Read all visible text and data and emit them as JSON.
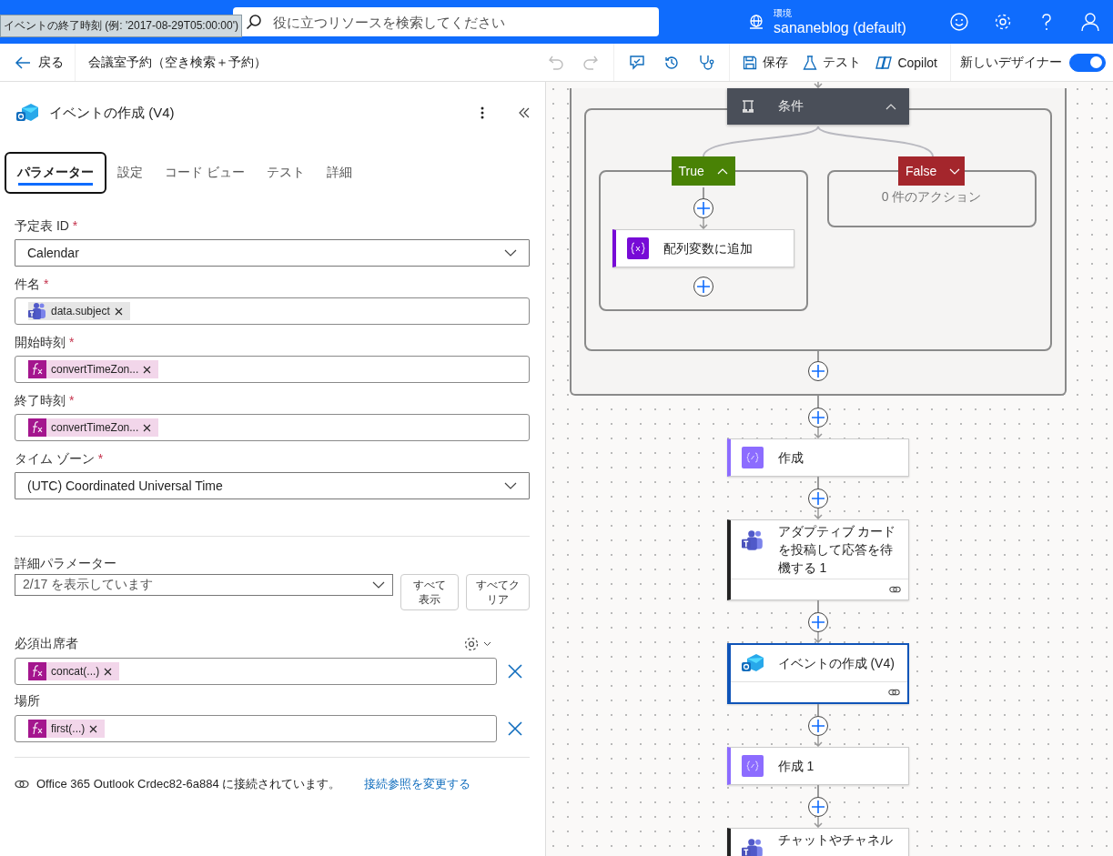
{
  "header": {
    "tooltip": "イベントの終了時刻 (例: '2017-08-29T05:00:00')",
    "search": {
      "placeholder": "役に立つリソースを検索してください"
    },
    "environment": {
      "label": "環境",
      "name": "sananeblog (default)"
    }
  },
  "toolbar": {
    "back": "戻る",
    "flow_name": "会議室予約（空き検索＋予約）",
    "undo": {
      "disabled": true
    },
    "redo": {
      "disabled": true
    },
    "actions": [
      {
        "kind": "save",
        "label": "保存"
      },
      {
        "kind": "test",
        "label": "テスト"
      },
      {
        "kind": "copilot",
        "label": "Copilot"
      }
    ],
    "new_designer": {
      "label": "新しいデザイナー",
      "on": true
    }
  },
  "panel": {
    "title": "イベントの作成 (V4)",
    "tabs": [
      {
        "label": "パラメーター",
        "selected": true
      },
      {
        "label": "設定",
        "selected": false
      },
      {
        "label": "コード ビュー",
        "selected": false
      },
      {
        "label": "テスト",
        "selected": false
      },
      {
        "label": "詳細",
        "selected": false
      }
    ],
    "fields": [
      {
        "kind": "dropdown",
        "label": "予定表 ID",
        "mark": "*",
        "value": "Calendar"
      },
      {
        "kind": "tokens",
        "label": "件名",
        "mark": "*",
        "tokens": [
          {
            "kind": "teams",
            "text": "data.subject"
          }
        ]
      },
      {
        "kind": "tokens",
        "label": "開始時刻",
        "mark": "*",
        "tokens": [
          {
            "kind": "expression",
            "text": "convertTimeZon..."
          }
        ]
      },
      {
        "kind": "tokens",
        "label": "終了時刻",
        "mark": "*",
        "tokens": [
          {
            "kind": "expression",
            "text": "convertTimeZon..."
          }
        ]
      },
      {
        "kind": "dropdown",
        "label": "タイム ゾーン",
        "mark": "*",
        "value": "(UTC) Coordinated Universal Time"
      }
    ],
    "advanced": {
      "label": "詳細パラメーター",
      "summary": "2/17 を表示しています",
      "buttons": [
        "すべて表示",
        "すべてクリア"
      ]
    },
    "optional_fields": [
      {
        "label": "必須出席者",
        "settings": true,
        "tokens": [
          {
            "kind": "expression",
            "text": "concat(...)"
          }
        ]
      },
      {
        "label": "場所",
        "settings": false,
        "tokens": [
          {
            "kind": "expression",
            "text": "first(...)"
          }
        ]
      }
    ],
    "connection": {
      "text": "Office 365 Outlook Crdec82-6a884 に接続されています。",
      "link": "接続参照を変更する"
    }
  },
  "canvas": {
    "condition": {
      "title": "条件",
      "expanded": true,
      "branches": [
        {
          "kind": "true",
          "label": "True",
          "expanded": true,
          "actions": [
            {
              "kind": "variable",
              "title": "配列変数に追加"
            }
          ]
        },
        {
          "kind": "false",
          "label": "False",
          "expanded": false,
          "empty_text": "0 件のアクション"
        }
      ]
    },
    "nodes": [
      {
        "kind": "compose",
        "title": "作成",
        "selected": false,
        "connection": false
      },
      {
        "kind": "teams",
        "title": "アダプティブ カードを投稿して応答を待機する 1",
        "selected": false,
        "connection": true
      },
      {
        "kind": "outlook",
        "title": "イベントの作成 (V4)",
        "selected": true,
        "connection": true
      },
      {
        "kind": "compose",
        "title": "作成 1",
        "selected": false,
        "connection": false
      },
      {
        "kind": "teams",
        "title": "チャットやチャネル",
        "selected": false
      }
    ]
  }
}
